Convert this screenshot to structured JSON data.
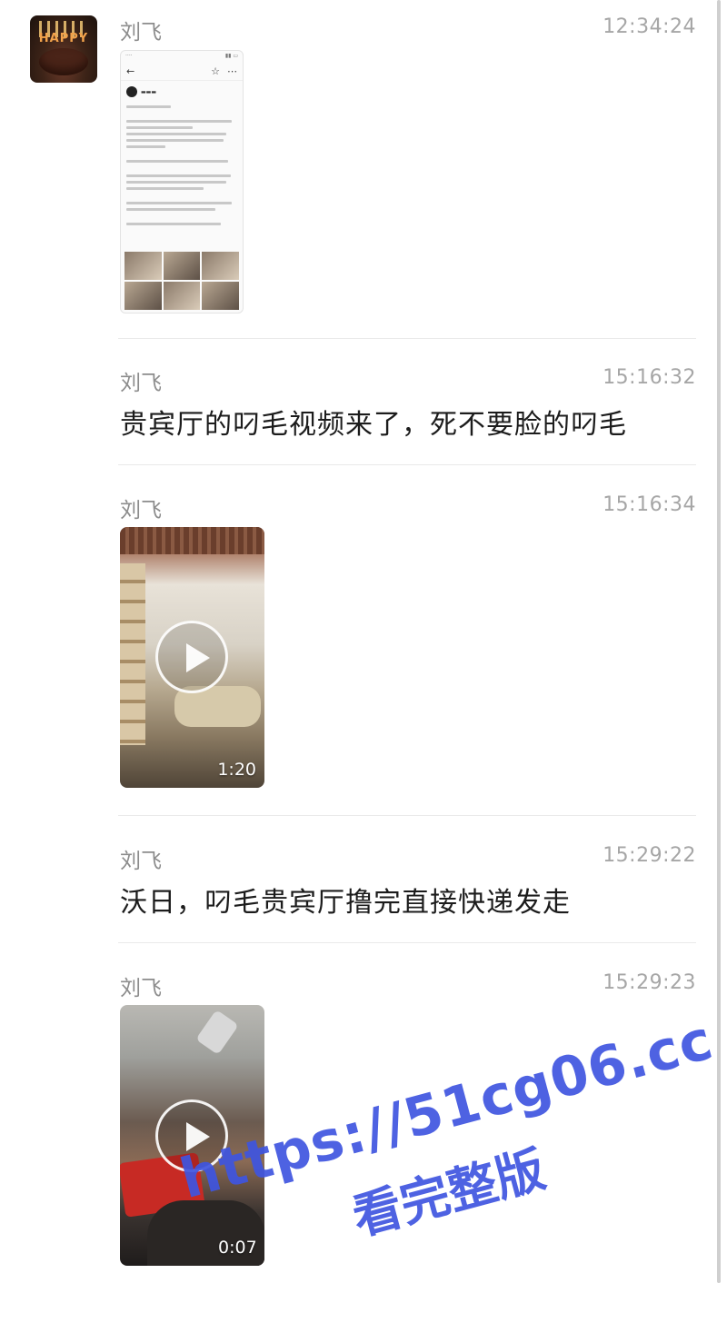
{
  "messages": [
    {
      "sender": "刘飞",
      "time": "12:34:24",
      "type": "image"
    },
    {
      "sender": "刘飞",
      "time": "15:16:32",
      "type": "text",
      "text": "贵宾厅的叼毛视频来了，死不要脸的叼毛"
    },
    {
      "sender": "刘飞",
      "time": "15:16:34",
      "type": "video",
      "duration": "1:20"
    },
    {
      "sender": "刘飞",
      "time": "15:29:22",
      "type": "text",
      "text": "沃日，叼毛贵宾厅撸完直接快递发走"
    },
    {
      "sender": "刘飞",
      "time": "15:29:23",
      "type": "video",
      "duration": "0:07"
    }
  ],
  "avatar": {
    "label": "HAPPY"
  },
  "watermark": {
    "url": "https://51cg06.cc",
    "caption": "看完整版"
  },
  "colors": {
    "background": "#ffffff",
    "timestamp": "#a6a6a6",
    "sender": "#8c8c8c",
    "watermark": "#3f55e0"
  }
}
